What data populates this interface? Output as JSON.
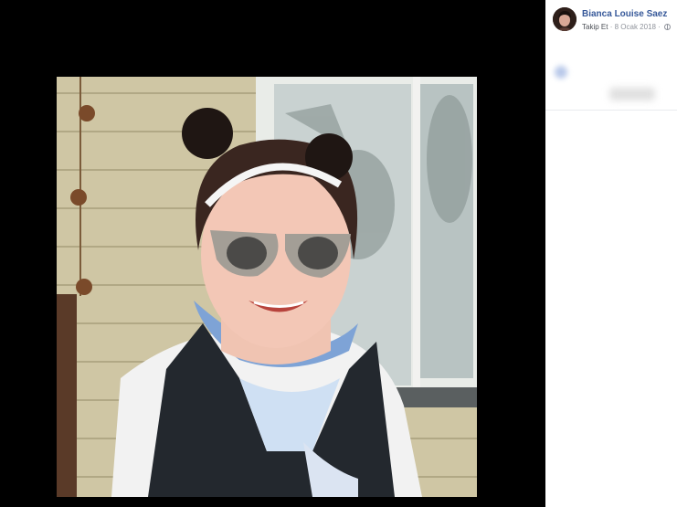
{
  "post": {
    "author_name": "Bianca Louise Saez",
    "follow_label": "Takip Et",
    "separator": "·",
    "date": "8 Ocak 2018",
    "privacy_icon": "globe-icon"
  },
  "colors": {
    "author_link": "#365899",
    "meta_text": "#90949c",
    "viewer_bg": "#000000",
    "sidebar_bg": "#ffffff"
  }
}
